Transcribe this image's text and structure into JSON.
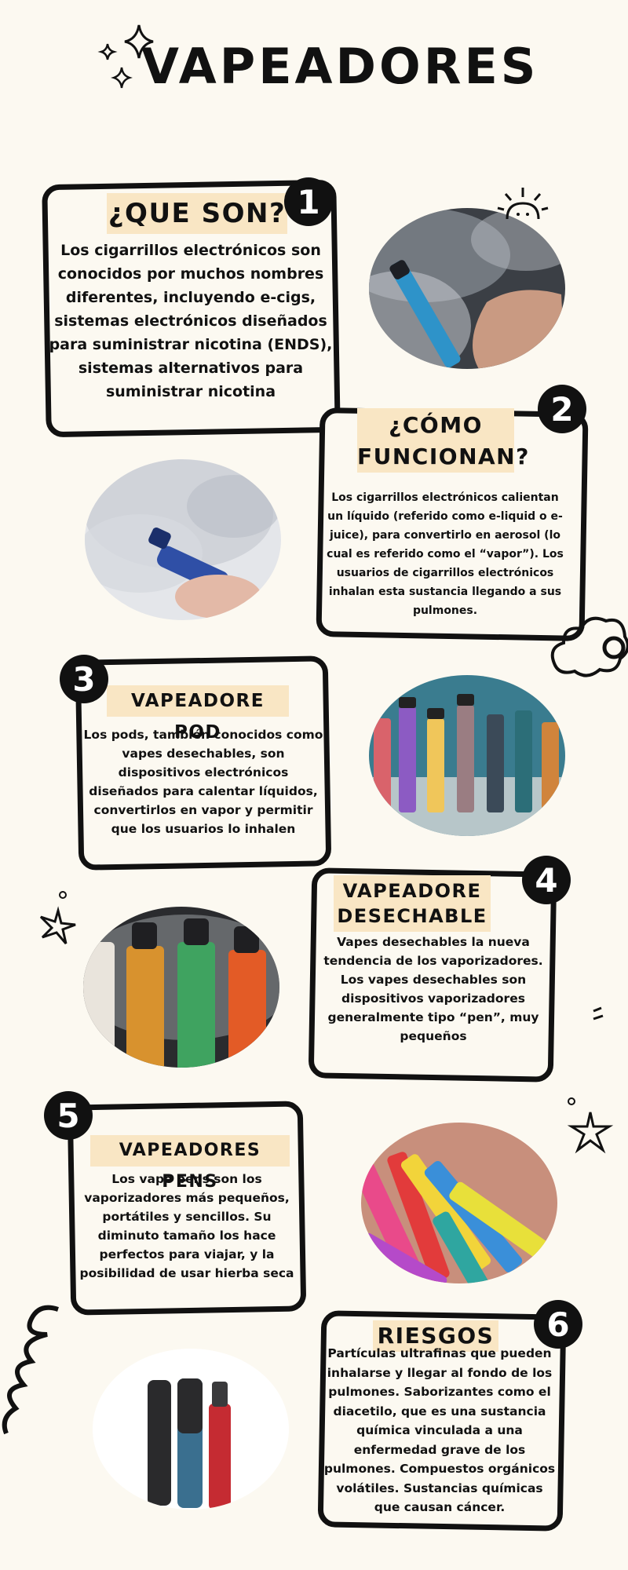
{
  "title": "VAPEADORES",
  "sections": [
    {
      "number": "1",
      "heading": "¿QUE SON?",
      "text": "Los cigarrillos electrónicos son conocidos por muchos nombres diferentes, incluyendo e-cigs, sistemas electrónicos diseñados para suministrar nicotina (ENDS), sistemas alternativos para suministrar nicotina"
    },
    {
      "number": "2",
      "heading": "¿CÓMO FUNCIONAN?",
      "text": "Los cigarrillos electrónicos calientan un líquido (referido como e-liquid o e-juice), para convertirlo en aerosol (lo cual es referido como el “vapor”). Los usuarios de cigarrillos electrónicos inhalan esta sustancia llegando a sus pulmones."
    },
    {
      "number": "3",
      "heading": "VAPEADORE POD",
      "text": "Los pods, también conocidos como vapes desechables, son dispositivos electrónicos diseñados para calentar líquidos, convertirlos en vapor y permitir que los usuarios lo inhalen"
    },
    {
      "number": "4",
      "heading": "VAPEADORE DESECHABLE",
      "text": "Vapes desechables la nueva tendencia de los vaporizadores. Los vapes desechables son dispositivos vaporizadores generalmente tipo “pen”, muy pequeños"
    },
    {
      "number": "5",
      "heading": "VAPEADORES PENS",
      "text": "Los vape pens son los vaporizadores más pequeños, portátiles y sencillos. Su diminuto tamaño los hace perfectos para viajar, y la posibilidad de usar hierba seca"
    },
    {
      "number": "6",
      "heading": "RIESGOS",
      "text": "Partículas ultrafinas que pueden inhalarse y llegar al fondo de los pulmones. Saborizantes como el diacetilo, que es una sustancia química vinculada a una enfermedad grave de los pulmones. Compuestos orgánicos volátiles. Sustancias químicas que causan cáncer."
    }
  ],
  "colors": {
    "background": "#fcf9f1",
    "highlight": "#f9e6c4",
    "ink": "#111111"
  }
}
